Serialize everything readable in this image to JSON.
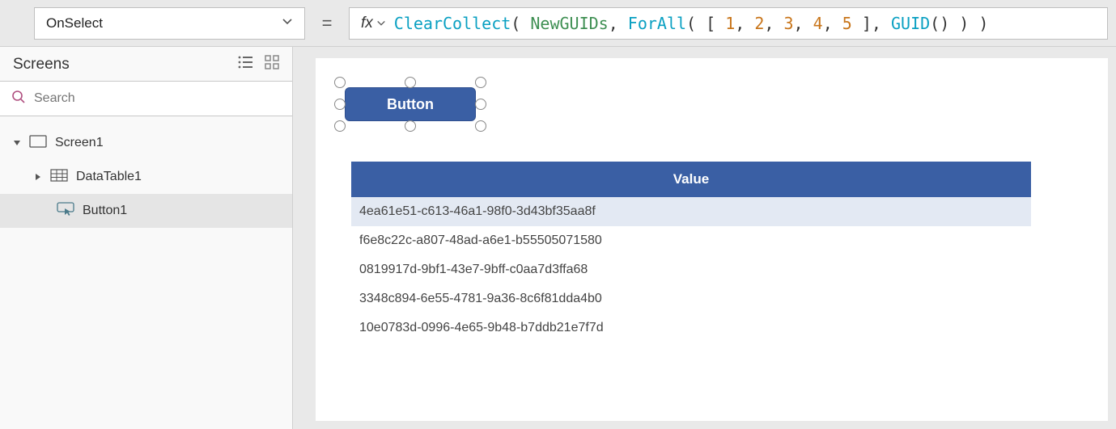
{
  "topbar": {
    "property_selected": "OnSelect",
    "fx_label": "fx",
    "formula_tokens": [
      {
        "t": "ClearCollect",
        "c": "t-fn"
      },
      {
        "t": "( ",
        "c": "t-plain"
      },
      {
        "t": "NewGUIDs",
        "c": "t-var"
      },
      {
        "t": ", ",
        "c": "t-plain"
      },
      {
        "t": "ForAll",
        "c": "t-fn"
      },
      {
        "t": "( [ ",
        "c": "t-plain"
      },
      {
        "t": "1",
        "c": "t-num"
      },
      {
        "t": ", ",
        "c": "t-plain"
      },
      {
        "t": "2",
        "c": "t-num"
      },
      {
        "t": ", ",
        "c": "t-plain"
      },
      {
        "t": "3",
        "c": "t-num"
      },
      {
        "t": ", ",
        "c": "t-plain"
      },
      {
        "t": "4",
        "c": "t-num"
      },
      {
        "t": ", ",
        "c": "t-plain"
      },
      {
        "t": "5",
        "c": "t-num"
      },
      {
        "t": " ], ",
        "c": "t-plain"
      },
      {
        "t": "GUID",
        "c": "t-fn"
      },
      {
        "t": "() ) )",
        "c": "t-plain"
      }
    ]
  },
  "left": {
    "panel_title": "Screens",
    "search_placeholder": "Search",
    "tree": {
      "screen": "Screen1",
      "datatable": "DataTable1",
      "button": "Button1"
    }
  },
  "canvas": {
    "button_label": "Button",
    "table": {
      "header": "Value",
      "rows": [
        "4ea61e51-c613-46a1-98f0-3d43bf35aa8f",
        "f6e8c22c-a807-48ad-a6e1-b55505071580",
        "0819917d-9bf1-43e7-9bff-c0aa7d3ffa68",
        "3348c894-6e55-4781-9a36-8c6f81dda4b0",
        "10e0783d-0996-4e65-9b48-b7ddb21e7f7d"
      ]
    }
  }
}
